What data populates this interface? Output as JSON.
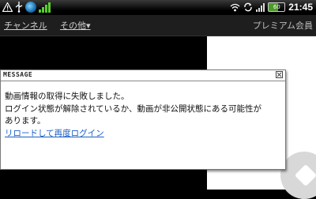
{
  "statusbar": {
    "icons_left": [
      "warning-icon",
      "usb-icon",
      "globe-icon",
      "signal-green-icon"
    ],
    "icons_right": [
      "wifi-icon",
      "sync-icon",
      "signal-icon",
      "battery-icon"
    ],
    "battery_label": "60",
    "time": "21:45"
  },
  "navbar": {
    "channel": "チャンネル",
    "other": "その他▾",
    "premium": "プレミアム会員"
  },
  "dialog": {
    "title": "MESSAGE",
    "line1": "動画情報の取得に失敗しました。",
    "line2": "ログイン状態が解除されているか、動画が非公開状態にある可能性が",
    "line3": "あります。",
    "link": "リロードして再度ログイン"
  },
  "colors": {
    "link": "#1a5fc8",
    "signal": "#5ad02c"
  }
}
